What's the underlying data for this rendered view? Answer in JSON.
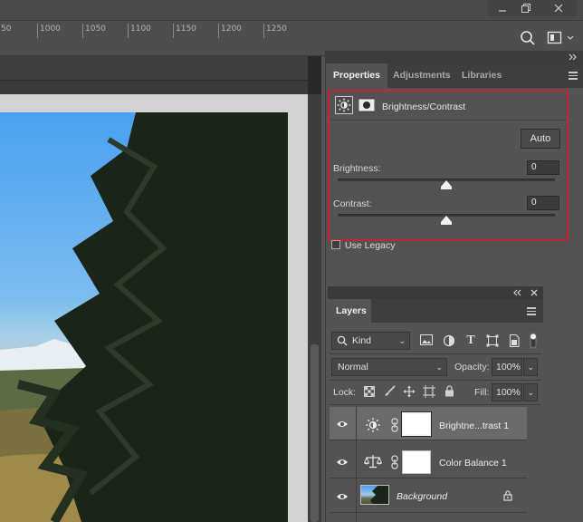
{
  "ruler": {
    "ticks": [
      "50",
      "1000",
      "1050",
      "1100",
      "1150",
      "1200",
      "1250"
    ]
  },
  "tabs": {
    "properties": "Properties",
    "adjustments": "Adjustments",
    "libraries": "Libraries"
  },
  "properties": {
    "title": "Brightness/Contrast",
    "auto_label": "Auto",
    "brightness_label": "Brightness:",
    "brightness_value": "0",
    "contrast_label": "Contrast:",
    "contrast_value": "0",
    "legacy_label": "Use Legacy"
  },
  "layers": {
    "tab_label": "Layers",
    "filter_kind": "Kind",
    "blend_mode": "Normal",
    "opacity_label": "Opacity:",
    "opacity_value": "100%",
    "lock_label": "Lock:",
    "fill_label": "Fill:",
    "fill_value": "100%",
    "items": [
      {
        "name": "Brightne...trast 1",
        "selected": true,
        "icon": "brightness-icon"
      },
      {
        "name": "Color Balance 1",
        "selected": false,
        "icon": "balance-scale-icon"
      },
      {
        "name": "Background",
        "selected": false,
        "icon": "photo-thumbnail",
        "locked": true
      }
    ]
  },
  "colors": {
    "highlight_border": "#c8242e",
    "panel_bg": "#535353",
    "tab_bg": "#3e3e3e"
  }
}
